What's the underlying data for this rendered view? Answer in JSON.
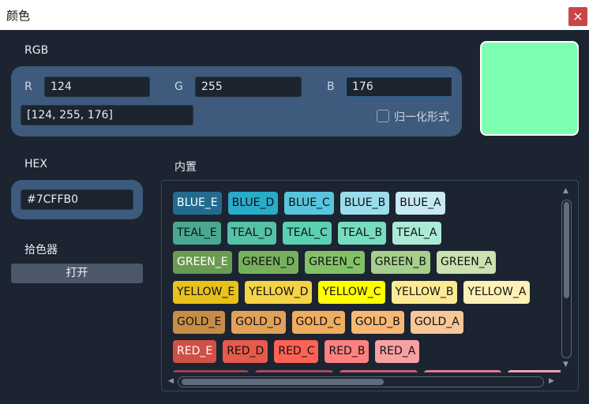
{
  "window": {
    "title": "颜色",
    "close_label": "×"
  },
  "rgb": {
    "section_label": "RGB",
    "r_label": "R",
    "r_value": "124",
    "g_label": "G",
    "g_value": "255",
    "b_label": "B",
    "b_value": "176",
    "list_value": "[124, 255, 176]",
    "normalize_label": "归一化形式",
    "normalize_checked": false
  },
  "preview": {
    "color": "#7CFFB0"
  },
  "hex": {
    "section_label": "HEX",
    "value": "#7CFFB0"
  },
  "picker": {
    "section_label": "拾色器",
    "button_label": "打开"
  },
  "builtin": {
    "section_label": "内置",
    "rows": [
      {
        "chips": [
          {
            "label": "BLUE_E",
            "bg": "#236B8E",
            "fg": "#ffffff"
          },
          {
            "label": "BLUE_D",
            "bg": "#29ABCA",
            "fg": "#111111"
          },
          {
            "label": "BLUE_C",
            "bg": "#58C4DD",
            "fg": "#111111"
          },
          {
            "label": "BLUE_B",
            "bg": "#9CDCEB",
            "fg": "#111111"
          },
          {
            "label": "BLUE_A",
            "bg": "#C7E9F1",
            "fg": "#111111"
          }
        ]
      },
      {
        "chips": [
          {
            "label": "TEAL_E",
            "bg": "#49A88F",
            "fg": "#111111"
          },
          {
            "label": "TEAL_D",
            "bg": "#55C1A7",
            "fg": "#111111"
          },
          {
            "label": "TEAL_C",
            "bg": "#5CD0B3",
            "fg": "#111111"
          },
          {
            "label": "TEAL_B",
            "bg": "#76DDC0",
            "fg": "#111111"
          },
          {
            "label": "TEAL_A",
            "bg": "#ACEAD7",
            "fg": "#111111"
          }
        ]
      },
      {
        "chips": [
          {
            "label": "GREEN_E",
            "bg": "#699C52",
            "fg": "#ffffff"
          },
          {
            "label": "GREEN_D",
            "bg": "#77B05D",
            "fg": "#111111"
          },
          {
            "label": "GREEN_C",
            "bg": "#83C167",
            "fg": "#111111"
          },
          {
            "label": "GREEN_B",
            "bg": "#A6CF8C",
            "fg": "#111111"
          },
          {
            "label": "GREEN_A",
            "bg": "#C9E2AE",
            "fg": "#111111"
          }
        ]
      },
      {
        "chips": [
          {
            "label": "YELLOW_E",
            "bg": "#E8C11C",
            "fg": "#111111"
          },
          {
            "label": "YELLOW_D",
            "bg": "#F4D345",
            "fg": "#111111"
          },
          {
            "label": "YELLOW_C",
            "bg": "#FFFF00",
            "fg": "#111111"
          },
          {
            "label": "YELLOW_B",
            "bg": "#FFEA94",
            "fg": "#111111"
          },
          {
            "label": "YELLOW_A",
            "bg": "#FFF1B6",
            "fg": "#111111"
          }
        ]
      },
      {
        "chips": [
          {
            "label": "GOLD_E",
            "bg": "#C78D46",
            "fg": "#111111"
          },
          {
            "label": "GOLD_D",
            "bg": "#E1A158",
            "fg": "#111111"
          },
          {
            "label": "GOLD_C",
            "bg": "#F0AC5F",
            "fg": "#111111"
          },
          {
            "label": "GOLD_B",
            "bg": "#F9B775",
            "fg": "#111111"
          },
          {
            "label": "GOLD_A",
            "bg": "#F7C797",
            "fg": "#111111"
          }
        ]
      },
      {
        "chips": [
          {
            "label": "RED_E",
            "bg": "#CF5044",
            "fg": "#ffffff"
          },
          {
            "label": "RED_D",
            "bg": "#E65A4C",
            "fg": "#111111"
          },
          {
            "label": "RED_C",
            "bg": "#FC6255",
            "fg": "#111111"
          },
          {
            "label": "RED_B",
            "bg": "#FF8080",
            "fg": "#111111"
          },
          {
            "label": "RED_A",
            "bg": "#F7A1A3",
            "fg": "#111111"
          }
        ]
      },
      {
        "chips": [
          {
            "label": "",
            "bg": "#94424F",
            "fg": "#ffffff"
          },
          {
            "label": "",
            "bg": "#A24D61",
            "fg": "#ffffff"
          },
          {
            "label": "",
            "bg": "#C55F73",
            "fg": "#111111"
          },
          {
            "label": "",
            "bg": "#E07A8F",
            "fg": "#111111"
          },
          {
            "label": "",
            "bg": "#E8A3B4",
            "fg": "#111111"
          }
        ]
      }
    ]
  }
}
